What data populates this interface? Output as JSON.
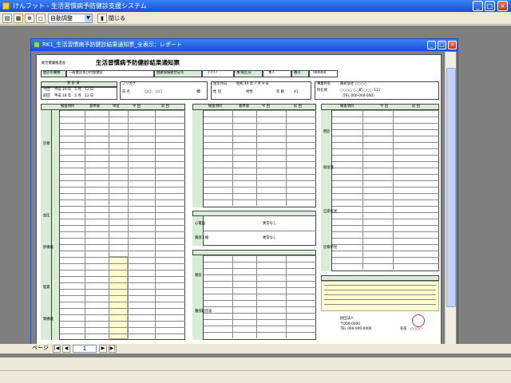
{
  "app": {
    "title": "けんフット - 生活習慣病予防健診支援システム",
    "buttons": {
      "min": "_",
      "max": "□",
      "close": "×"
    }
  },
  "toolbar": {
    "zoom_value": "自動調整",
    "close_label": "閉じる"
  },
  "report_window": {
    "title": "RK1_生活習慣病予防健診結果通知票_全表示：レポート"
  },
  "report": {
    "org": "総合健康推進会",
    "title": "生活習慣病予防健診結果通知票",
    "code_label": "健診の種類",
    "code_value": "一般健診及び付加健診",
    "ins_label": "健康保険組合記号",
    "ins_value": "77/77",
    "kind_label": "本/家区分",
    "kind_value": "本人",
    "age_label": "番号",
    "age_value": "000000",
    "exam_date_label": "受 診 日",
    "date1_label": "今回",
    "date1": "平成 19 年　5 月　12 日",
    "date2_label": "前回",
    "date2": "平成 18 年　5 月　12 日",
    "furigana_label": "フリガナ",
    "name_label": "氏 名",
    "name_value": "○○　○○",
    "honorific": "様",
    "birth_label": "生年月日",
    "birth_value": "昭和 40 年 7 月 9 日",
    "sex_label": "性 別",
    "sex_value": "男性",
    "age2_label": "年 齢",
    "age2_value": "41",
    "company_label": "事業所名",
    "company_value": "株式会社 ○○○○",
    "address_label": "所在地",
    "address_value": "○○○○ ○○町 ○○○ 111",
    "tel_value": "（TEL 000-000-000）",
    "col_item": "検査項目",
    "col_std": "基準値",
    "col_unit": "単位",
    "col_this": "今 回",
    "col_prev": "前 回",
    "section_left": [
      "診察",
      "身体計測",
      "血圧",
      "肝機能",
      "脂質",
      "糖代謝",
      "腎機能",
      "尿検査"
    ],
    "section_mid": [
      "心電図",
      "胸部Ｘ線",
      "眼底",
      "腹部超音波"
    ],
    "section_right": [
      "問診",
      "既往歴",
      "自覚症状",
      "診察所見"
    ],
    "result_none": "異常なし",
    "result_special": "特に異常なし",
    "footer_org": "財団法人",
    "footer_name": "名前　○○○○",
    "footer_tel": "TEL 000-000-0000",
    "footer_addr": "〒000-0000"
  },
  "pagebar": {
    "label": "ページ",
    "page": "1"
  },
  "colors": {
    "titlebar": "#1f5be0",
    "band": "#d8ecd8",
    "yellow": "#ffffcc",
    "mdi_bg": "#7f7f7f"
  }
}
